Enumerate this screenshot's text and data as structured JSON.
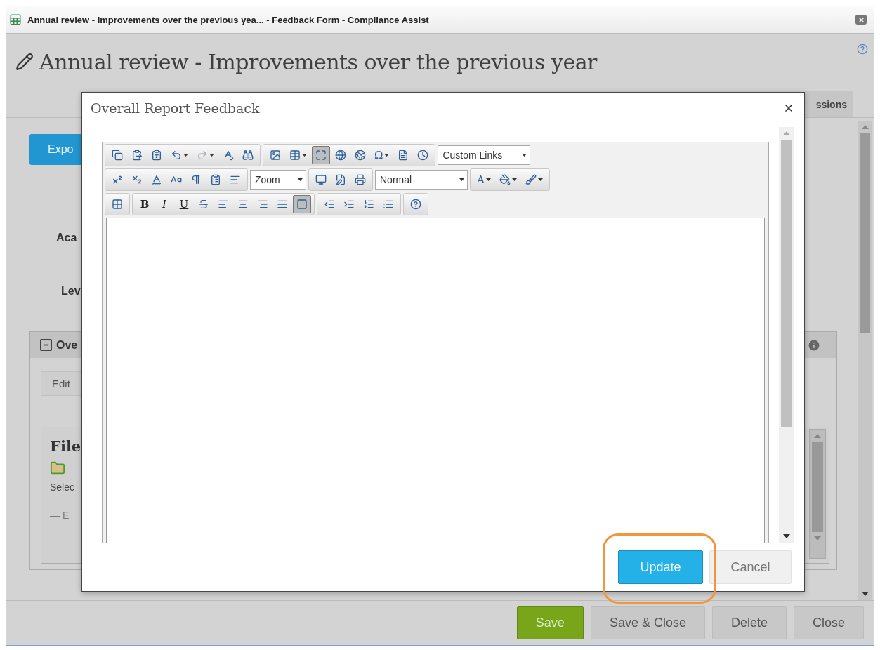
{
  "window": {
    "title": "Annual review - Improvements over the previous yea... - Feedback Form - Compliance Assist"
  },
  "page": {
    "title": "Annual review - Improvements over the previous year",
    "tabs": [
      {
        "label": "ssions",
        "selected": false
      }
    ],
    "export_button": "Expo",
    "fields": [
      "Aca",
      "Lev"
    ],
    "section": {
      "title": "Ove",
      "expanded": true,
      "edit_button": "Edit",
      "file_panel": {
        "title": "File",
        "text": "Selec",
        "item": {
          "label": "— E",
          "disabled": true
        }
      }
    },
    "buttons": [
      {
        "label": "Save",
        "kind": "primary"
      },
      {
        "label": "Save & Close",
        "kind": "default"
      },
      {
        "label": "Delete",
        "kind": "default"
      },
      {
        "label": "Close",
        "kind": "default"
      }
    ]
  },
  "dialog": {
    "title": "Overall Report Feedback",
    "toolbar": [
      [
        [
          {
            "kind": "icon"
          },
          {
            "kind": "icon"
          },
          {
            "kind": "icon"
          },
          {
            "kind": "icon",
            "caret": true
          },
          {
            "kind": "icon",
            "caret": true,
            "disabled": true
          },
          {
            "kind": "icon"
          },
          {
            "kind": "icon"
          }
        ],
        [
          {
            "kind": "icon"
          },
          {
            "kind": "icon",
            "caret": true
          },
          {
            "kind": "icon",
            "pressed": true
          },
          {
            "kind": "icon"
          },
          {
            "kind": "icon"
          },
          {
            "kind": "text",
            "text": "Ω",
            "caret": true
          },
          {
            "kind": "icon"
          },
          {
            "kind": "icon"
          }
        ],
        [
          {
            "kind": "select",
            "value": "Custom Links"
          }
        ]
      ],
      [
        [
          {
            "kind": "icon"
          },
          {
            "kind": "icon"
          },
          {
            "kind": "icon"
          },
          {
            "kind": "icon"
          },
          {
            "kind": "icon"
          },
          {
            "kind": "icon"
          },
          {
            "kind": "icon"
          }
        ],
        [
          {
            "kind": "select",
            "value": "Zoom"
          }
        ],
        [
          {
            "kind": "icon"
          },
          {
            "kind": "icon"
          },
          {
            "kind": "icon"
          }
        ],
        [
          {
            "kind": "select",
            "value": "Normal"
          }
        ],
        [
          {
            "kind": "text",
            "text": "A",
            "caret": true
          },
          {
            "kind": "icon",
            "caret": true
          },
          {
            "kind": "icon",
            "caret": true
          }
        ]
      ],
      [
        [
          {
            "kind": "icon"
          }
        ],
        [
          {
            "kind": "text",
            "text": "B"
          },
          {
            "kind": "text",
            "text": "I"
          },
          {
            "kind": "text",
            "text": "U"
          },
          {
            "kind": "icon"
          },
          {
            "kind": "icon"
          },
          {
            "kind": "icon"
          },
          {
            "kind": "icon"
          },
          {
            "kind": "icon"
          },
          {
            "kind": "icon",
            "pressed": true
          }
        ],
        [
          {
            "kind": "icon"
          },
          {
            "kind": "icon"
          },
          {
            "kind": "icon"
          },
          {
            "kind": "icon"
          }
        ],
        [
          {
            "kind": "icon"
          }
        ]
      ]
    ],
    "buttons": [
      {
        "label": "Update",
        "kind": "primary",
        "highlighted": true
      },
      {
        "label": "Cancel",
        "kind": "default",
        "highlighted": false
      }
    ]
  }
}
